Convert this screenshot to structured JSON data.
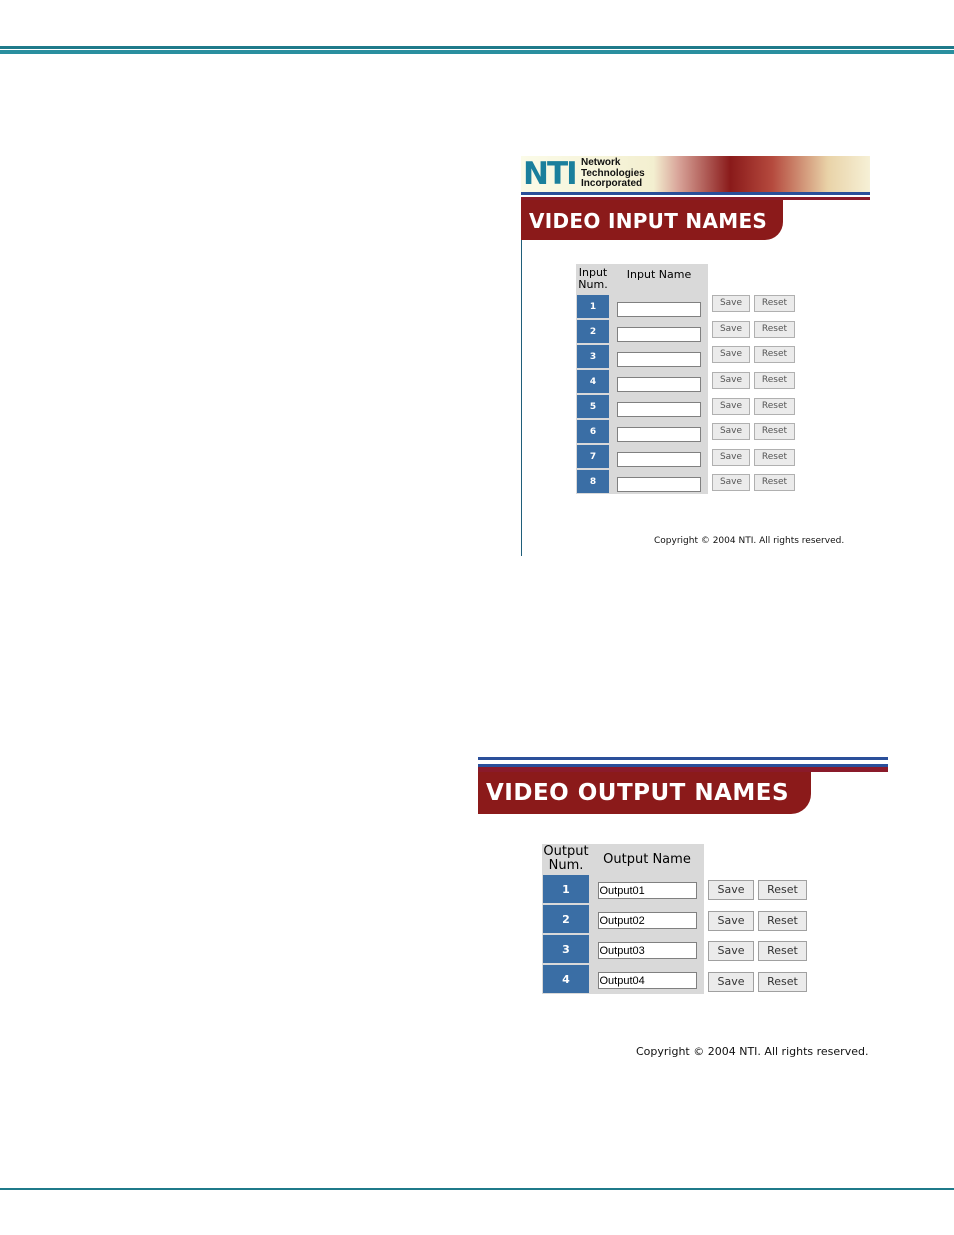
{
  "input_page": {
    "logo_text": "NTI",
    "company_lines": [
      "Network",
      "Technologies",
      "Incorporated"
    ],
    "title": "VIDEO INPUT NAMES",
    "col_num": "Input Num.",
    "col_name": "Input Name",
    "rows": [
      {
        "num": "1",
        "value": "",
        "save": "Save",
        "reset": "Reset"
      },
      {
        "num": "2",
        "value": "",
        "save": "Save",
        "reset": "Reset"
      },
      {
        "num": "3",
        "value": "",
        "save": "Save",
        "reset": "Reset"
      },
      {
        "num": "4",
        "value": "",
        "save": "Save",
        "reset": "Reset"
      },
      {
        "num": "5",
        "value": "",
        "save": "Save",
        "reset": "Reset"
      },
      {
        "num": "6",
        "value": "",
        "save": "Save",
        "reset": "Reset"
      },
      {
        "num": "7",
        "value": "",
        "save": "Save",
        "reset": "Reset"
      },
      {
        "num": "8",
        "value": "",
        "save": "Save",
        "reset": "Reset"
      }
    ],
    "copyright": "Copyright © 2004 NTI. All rights reserved."
  },
  "output_page": {
    "title": "VIDEO OUTPUT NAMES",
    "col_num": "Output Num.",
    "col_name": "Output Name",
    "rows": [
      {
        "num": "1",
        "value": "Output01",
        "save": "Save",
        "reset": "Reset"
      },
      {
        "num": "2",
        "value": "Output02",
        "save": "Save",
        "reset": "Reset"
      },
      {
        "num": "3",
        "value": "Output03",
        "save": "Save",
        "reset": "Reset"
      },
      {
        "num": "4",
        "value": "Output04",
        "save": "Save",
        "reset": "Reset"
      }
    ],
    "copyright": "Copyright © 2004 NTI. All rights reserved."
  },
  "colors": {
    "title_bar": "#8b1a1a",
    "num_cell": "#3a6ea5",
    "page_rule": "#1f7a8a"
  }
}
